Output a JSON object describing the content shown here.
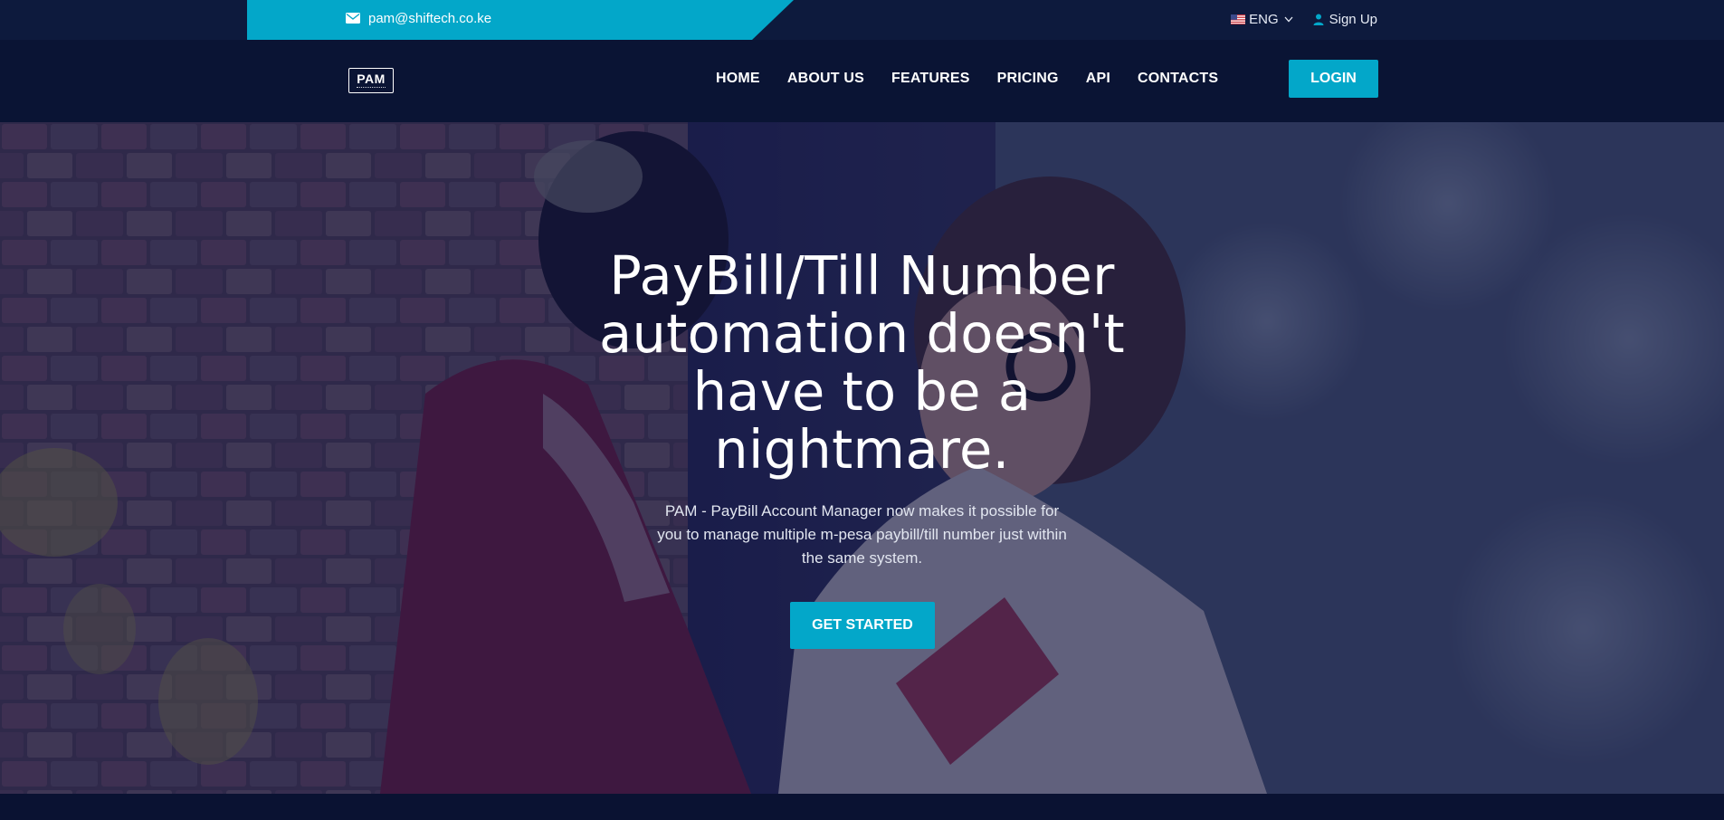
{
  "topbar": {
    "email": "pam@shiftech.co.ke",
    "language": "ENG",
    "signup_label": "Sign Up"
  },
  "nav": {
    "logo_text": "PAM",
    "items": [
      {
        "label": "HOME"
      },
      {
        "label": "ABOUT US"
      },
      {
        "label": "FEATURES"
      },
      {
        "label": "PRICING"
      },
      {
        "label": "API"
      },
      {
        "label": "CONTACTS"
      }
    ],
    "login_label": "LOGIN"
  },
  "hero": {
    "title": "PayBill/Till Number automation doesn't have to be a nightmare.",
    "subtitle": "PAM - PayBill Account Manager now makes it possible for you to manage multiple m-pesa paybill/till number just within the same system.",
    "cta_label": "GET STARTED"
  },
  "colors": {
    "accent": "#03a7c9",
    "navy": "#0a1434",
    "topbar": "#0d1a3d"
  },
  "icons": {
    "email": "mail-icon",
    "language_flag": "us-flag-icon",
    "language_caret": "chevron-down-icon",
    "signup": "user-icon"
  }
}
